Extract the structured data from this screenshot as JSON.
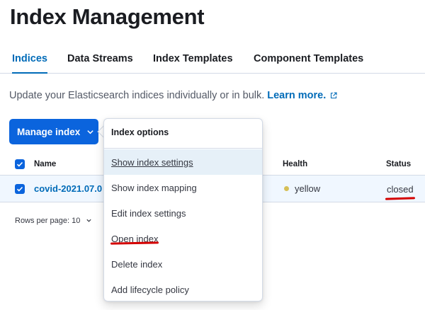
{
  "page": {
    "title": "Index Management"
  },
  "tabs": [
    {
      "label": "Indices",
      "active": true
    },
    {
      "label": "Data Streams",
      "active": false
    },
    {
      "label": "Index Templates",
      "active": false
    },
    {
      "label": "Component Templates",
      "active": false
    }
  ],
  "description": {
    "text": "Update your Elasticsearch indices individually or in bulk.",
    "link": "Learn more."
  },
  "manage_button": {
    "label": "Manage index"
  },
  "table": {
    "columns": {
      "name": "Name",
      "health": "Health",
      "status": "Status"
    },
    "rows": [
      {
        "name": "covid-2021.07.0",
        "health": "yellow",
        "status": "closed",
        "selected": true
      }
    ]
  },
  "pagination": {
    "rows_per_page": "Rows per page: 10"
  },
  "popover": {
    "title": "Index options",
    "items": [
      {
        "label": "Show index settings"
      },
      {
        "label": "Show index mapping"
      },
      {
        "label": "Edit index settings"
      },
      {
        "label": "Open index"
      },
      {
        "label": "Delete index"
      },
      {
        "label": "Add lifecycle policy"
      }
    ]
  },
  "colors": {
    "accent": "#006bb8",
    "button": "#0b64dd",
    "health_yellow": "#d6bf57",
    "annotation_red": "#d40000"
  },
  "icons": [
    "external-link-icon",
    "chevron-down-icon",
    "checkbox-checked-icon"
  ]
}
